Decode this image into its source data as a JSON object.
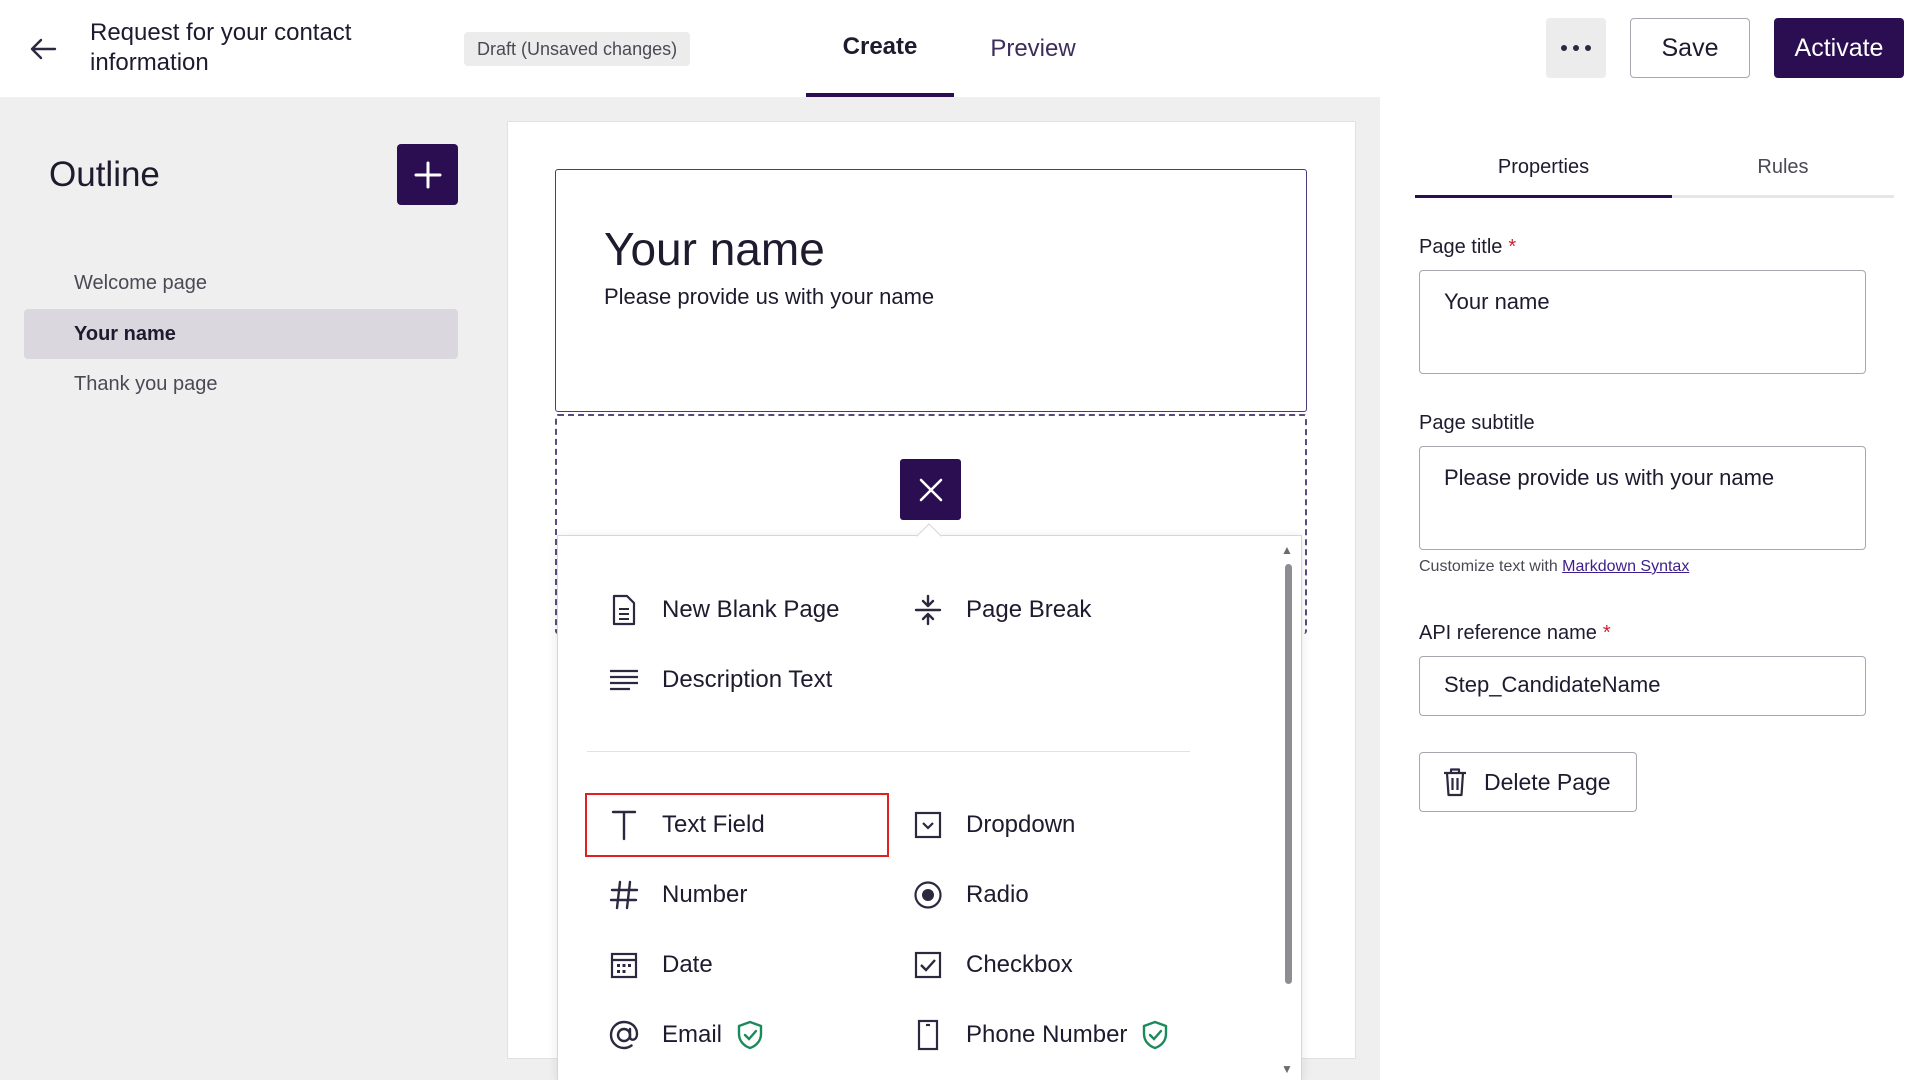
{
  "header": {
    "title": "Request for your contact information",
    "draft_badge": "Draft (Unsaved changes)",
    "tabs": [
      {
        "label": "Create"
      },
      {
        "label": "Preview"
      }
    ],
    "save_label": "Save",
    "activate_label": "Activate"
  },
  "outline": {
    "title": "Outline",
    "items": [
      {
        "label": "Welcome page"
      },
      {
        "label": "Your name"
      },
      {
        "label": "Thank you page"
      }
    ]
  },
  "canvas": {
    "page_title": "Your name",
    "page_subtitle": "Please provide us with your name"
  },
  "popover": {
    "layout_items": [
      {
        "label": "New Blank Page",
        "icon": "page-icon"
      },
      {
        "label": "Page Break",
        "icon": "page-break-icon"
      },
      {
        "label": "Description Text",
        "icon": "description-icon"
      }
    ],
    "field_items": [
      {
        "label": "Text Field",
        "icon": "text-icon"
      },
      {
        "label": "Dropdown",
        "icon": "dropdown-icon"
      },
      {
        "label": "Number",
        "icon": "hash-icon"
      },
      {
        "label": "Radio",
        "icon": "radio-icon"
      },
      {
        "label": "Date",
        "icon": "calendar-icon"
      },
      {
        "label": "Checkbox",
        "icon": "checkbox-icon"
      },
      {
        "label": "Email",
        "icon": "at-icon"
      },
      {
        "label": "Phone Number",
        "icon": "phone-icon"
      }
    ],
    "highlight_color": "#e02020"
  },
  "properties": {
    "tabs": [
      {
        "label": "Properties"
      },
      {
        "label": "Rules"
      }
    ],
    "page_title_label": "Page title",
    "page_title_value": "Your name",
    "page_subtitle_label": "Page subtitle",
    "page_subtitle_value": "Please provide us with your name",
    "help_prefix": "Customize text with ",
    "help_link": "Markdown Syntax",
    "api_label": "API reference name",
    "api_value": "Step_CandidateName",
    "delete_label": "Delete Page",
    "required_mark": "*"
  },
  "colors": {
    "accent": "#2b0e52",
    "required": "#d01f2f",
    "shield": "#1a8a5a"
  }
}
